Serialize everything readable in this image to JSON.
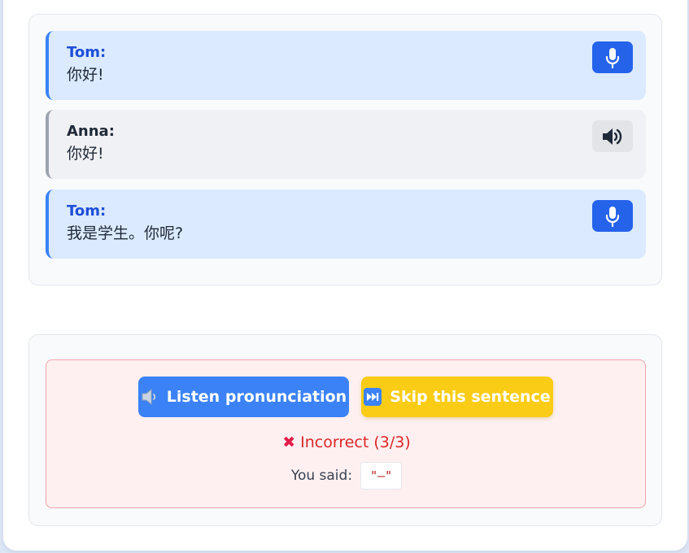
{
  "dialog": {
    "lines": [
      {
        "speaker": "Tom:",
        "text": "你好!",
        "role": "user",
        "action": "mic-icon"
      },
      {
        "speaker": "Anna:",
        "text": "你好!",
        "role": "partner",
        "action": "speaker-icon"
      },
      {
        "speaker": "Tom:",
        "text": "我是学生。你呢?",
        "role": "user",
        "action": "mic-icon"
      }
    ]
  },
  "feedback": {
    "listen_label": "Listen pronunciation",
    "listen_icon": "speaker-low-icon",
    "skip_label": "Skip this sentence",
    "skip_icon": "fast-forward-icon",
    "status_text": "Incorrect (3/3)",
    "status_icon": "cross-mark-icon",
    "you_said_label": "You said:",
    "you_said_value": "\"—\""
  },
  "colors": {
    "user_accent": "#3b82f6",
    "mic_button": "#2563eb",
    "listen_button": "#3b82f6",
    "skip_button": "#facc15",
    "error": "#dc2626",
    "error_bg": "#fef0f1"
  }
}
